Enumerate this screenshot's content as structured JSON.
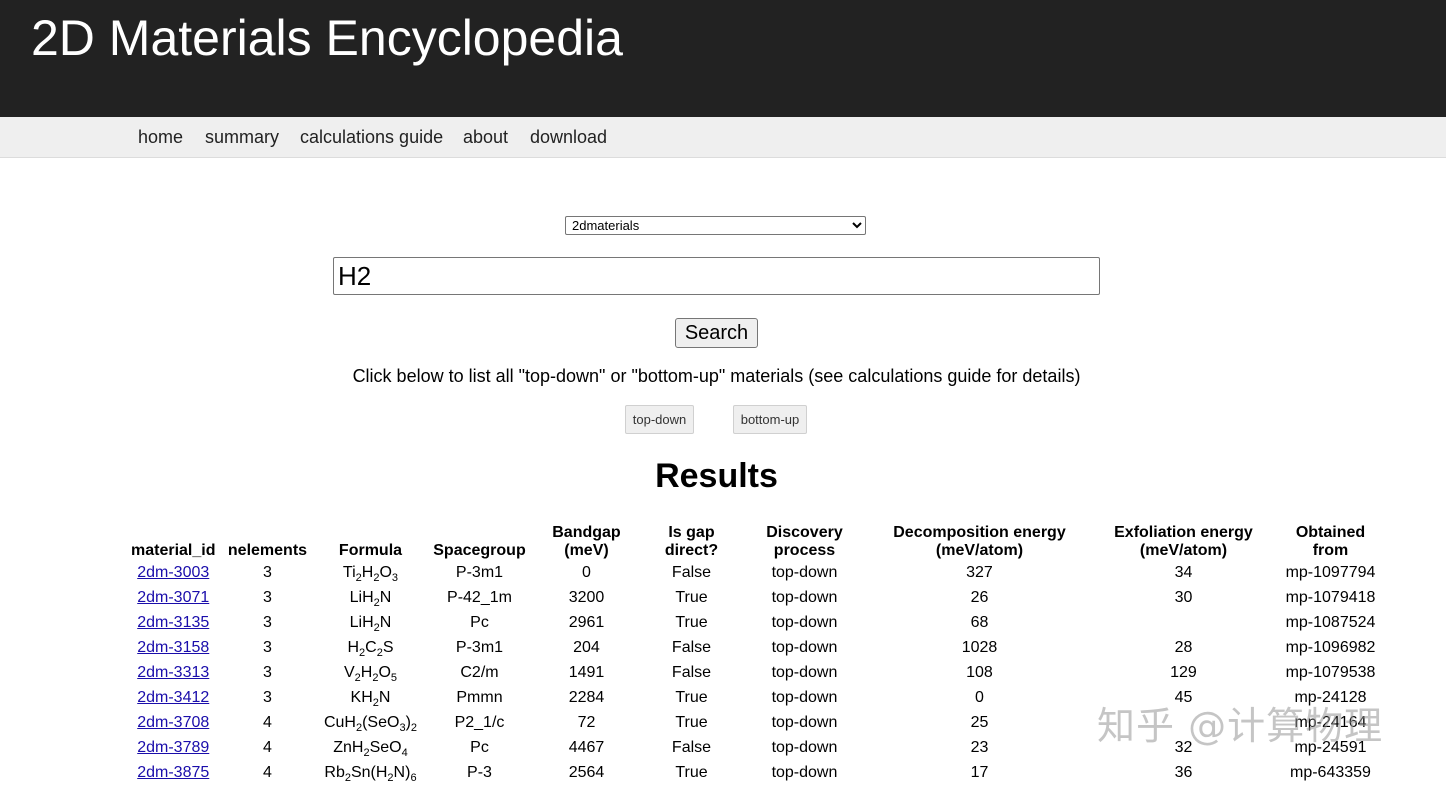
{
  "header": {
    "title": "2D Materials Encyclopedia"
  },
  "nav": {
    "items": [
      {
        "label": "home"
      },
      {
        "label": "summary"
      },
      {
        "label": "calculations guide"
      },
      {
        "label": "about"
      },
      {
        "label": "download"
      }
    ]
  },
  "search": {
    "db_selected": "2dmaterials",
    "query": "H2",
    "button_label": "Search",
    "hint": "Click below to list all \"top-down\" or \"bottom-up\" materials (see calculations guide for details)",
    "top_down_label": "top-down",
    "bottom_up_label": "bottom-up"
  },
  "results": {
    "heading": "Results",
    "columns": [
      "material_id",
      "nelements",
      "Formula",
      "Spacegroup",
      "Bandgap\n(meV)",
      "Is gap\ndirect?",
      "Discovery\nprocess",
      "Decomposition energy\n(meV/atom)",
      "Exfoliation energy\n(meV/atom)",
      "Obtained\nfrom"
    ],
    "rows": [
      {
        "id": "2dm-3003",
        "nelements": "3",
        "formula": [
          [
            "Ti",
            "2"
          ],
          [
            "H",
            "2"
          ],
          [
            "O",
            "3"
          ]
        ],
        "spacegroup": "P-3m1",
        "bandgap": "0",
        "direct": "False",
        "process": "top-down",
        "decomp": "327",
        "exfol": "34",
        "source": "mp-1097794"
      },
      {
        "id": "2dm-3071",
        "nelements": "3",
        "formula": [
          [
            "LiH",
            "2"
          ],
          [
            "N",
            ""
          ]
        ],
        "spacegroup": "P-42_1m",
        "bandgap": "3200",
        "direct": "True",
        "process": "top-down",
        "decomp": "26",
        "exfol": "30",
        "source": "mp-1079418"
      },
      {
        "id": "2dm-3135",
        "nelements": "3",
        "formula": [
          [
            "LiH",
            "2"
          ],
          [
            "N",
            ""
          ]
        ],
        "spacegroup": "Pc",
        "bandgap": "2961",
        "direct": "True",
        "process": "top-down",
        "decomp": "68",
        "exfol": "",
        "source": "mp-1087524"
      },
      {
        "id": "2dm-3158",
        "nelements": "3",
        "formula": [
          [
            "H",
            "2"
          ],
          [
            "C",
            "2"
          ],
          [
            "S",
            ""
          ]
        ],
        "spacegroup": "P-3m1",
        "bandgap": "204",
        "direct": "False",
        "process": "top-down",
        "decomp": "1028",
        "exfol": "28",
        "source": "mp-1096982"
      },
      {
        "id": "2dm-3313",
        "nelements": "3",
        "formula": [
          [
            "V",
            "2"
          ],
          [
            "H",
            "2"
          ],
          [
            "O",
            "5"
          ]
        ],
        "spacegroup": "C2/m",
        "bandgap": "1491",
        "direct": "False",
        "process": "top-down",
        "decomp": "108",
        "exfol": "129",
        "source": "mp-1079538"
      },
      {
        "id": "2dm-3412",
        "nelements": "3",
        "formula": [
          [
            "KH",
            "2"
          ],
          [
            "N",
            ""
          ]
        ],
        "spacegroup": "Pmmn",
        "bandgap": "2284",
        "direct": "True",
        "process": "top-down",
        "decomp": "0",
        "exfol": "45",
        "source": "mp-24128"
      },
      {
        "id": "2dm-3708",
        "nelements": "4",
        "formula": [
          [
            "CuH",
            "2"
          ],
          [
            "(SeO",
            "3"
          ],
          [
            ")",
            "2"
          ]
        ],
        "spacegroup": "P2_1/c",
        "bandgap": "72",
        "direct": "True",
        "process": "top-down",
        "decomp": "25",
        "exfol": "",
        "source": "mp-24164"
      },
      {
        "id": "2dm-3789",
        "nelements": "4",
        "formula": [
          [
            "ZnH",
            "2"
          ],
          [
            "SeO",
            "4"
          ]
        ],
        "spacegroup": "Pc",
        "bandgap": "4467",
        "direct": "False",
        "process": "top-down",
        "decomp": "23",
        "exfol": "32",
        "source": "mp-24591"
      },
      {
        "id": "2dm-3875",
        "nelements": "4",
        "formula": [
          [
            "Rb",
            "2"
          ],
          [
            "Sn(H",
            "2"
          ],
          [
            "N)",
            "6"
          ]
        ],
        "spacegroup": "P-3",
        "bandgap": "2564",
        "direct": "True",
        "process": "top-down",
        "decomp": "17",
        "exfol": "36",
        "source": "mp-643359"
      }
    ]
  },
  "watermark": {
    "text": "知乎 @计算物理"
  }
}
